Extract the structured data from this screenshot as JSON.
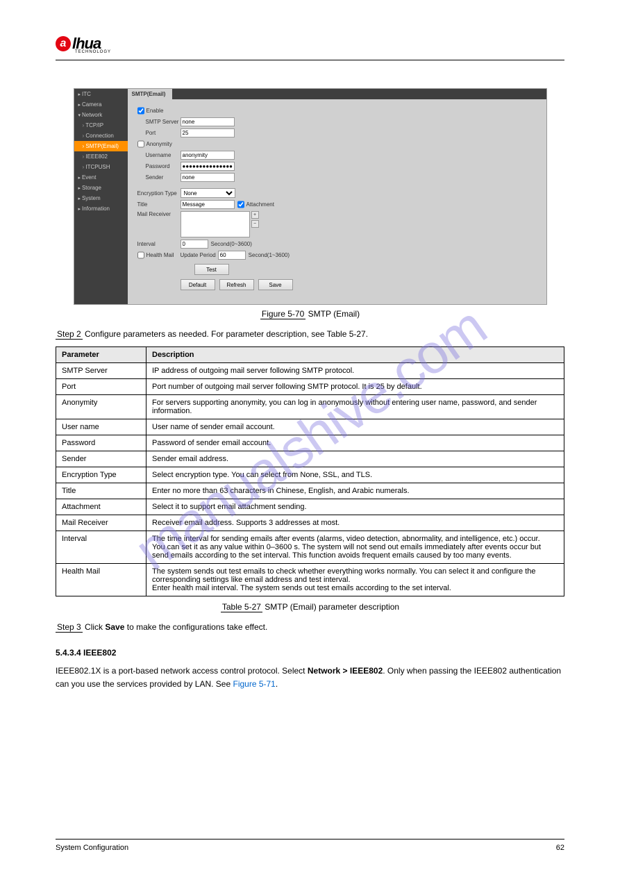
{
  "logo": {
    "brand": "lhua",
    "prefix": "a",
    "sub": "TECHNOLOGY"
  },
  "watermark": "manualshive.com",
  "sidebar": {
    "items": [
      {
        "label": "ITC",
        "cls": "collapse"
      },
      {
        "label": "Camera",
        "cls": "collapse"
      },
      {
        "label": "Network",
        "cls": "expand"
      },
      {
        "label": "TCP/IP",
        "cls": "sub sub-arrow"
      },
      {
        "label": "Connection",
        "cls": "sub sub-arrow"
      },
      {
        "label": "SMTP(Email)",
        "cls": "sub active sub-arrow"
      },
      {
        "label": "IEEE802",
        "cls": "sub sub-arrow"
      },
      {
        "label": "ITCPUSH",
        "cls": "sub sub-arrow"
      },
      {
        "label": "Event",
        "cls": "collapse"
      },
      {
        "label": "Storage",
        "cls": "collapse"
      },
      {
        "label": "System",
        "cls": "collapse"
      },
      {
        "label": "Information",
        "cls": "collapse"
      }
    ]
  },
  "form": {
    "tab": "SMTP(Email)",
    "enable_label": "Enable",
    "enable_checked": true,
    "smtp_server_label": "SMTP Server",
    "smtp_server_value": "none",
    "port_label": "Port",
    "port_value": "25",
    "anonymity_label": "Anonymity",
    "anonymity_checked": false,
    "username_label": "Username",
    "username_value": "anonymity",
    "password_label": "Password",
    "password_value": "●●●●●●●●●●●●●●●●●",
    "sender_label": "Sender",
    "sender_value": "none",
    "encryption_label": "Encryption Type",
    "encryption_value": "None",
    "title_label": "Title",
    "title_value": "Message",
    "attachment_label": "Attachment",
    "attachment_checked": true,
    "mail_receiver_label": "Mail Receiver",
    "interval_label": "Interval",
    "interval_value": "0",
    "interval_hint": "Second(0~3600)",
    "health_mail_label": "Health Mail",
    "health_mail_checked": false,
    "update_period_label": "Update Period",
    "update_period_value": "60",
    "update_period_hint": "Second(1~3600)",
    "test_btn": "Test",
    "default_btn": "Default",
    "refresh_btn": "Refresh",
    "save_btn": "Save"
  },
  "figure": {
    "label": "Figure 5-70",
    "title": "SMTP (Email)"
  },
  "step": {
    "prefix": "Step 2",
    "text": "Configure parameters as needed. For parameter description, see Table 5-27."
  },
  "table": {
    "headers": [
      "Parameter",
      "Description"
    ],
    "rows": [
      [
        "SMTP Server",
        "IP address of outgoing mail server following SMTP protocol."
      ],
      [
        "Port",
        "Port number of outgoing mail server following SMTP protocol. It is 25 by default."
      ],
      [
        "Anonymity",
        "For servers supporting anonymity, you can log in anonymously without entering user name, password, and sender information."
      ],
      [
        "User name",
        "User name of sender email account."
      ],
      [
        "Password",
        "Password of sender email account."
      ],
      [
        "Sender",
        "Sender email address."
      ],
      [
        "Encryption Type",
        "Select encryption type. You can select from None, SSL, and TLS."
      ],
      [
        "Title",
        "Enter no more than 63 characters in Chinese, English, and Arabic numerals."
      ],
      [
        "Attachment",
        "Select it to support email attachment sending."
      ],
      [
        "Mail Receiver",
        "Receiver email address. Supports 3 addresses at most."
      ],
      [
        "Interval",
        "The time interval for sending emails after events (alarms, video detection, abnormality, and intelligence, etc.) occur.\nYou can set it as any value within 0–3600 s. The system will not send out emails immediately after events occur but send emails according to the set interval. This function avoids frequent emails caused by too many events."
      ],
      [
        "Health Mail",
        "The system sends out test emails to check whether everything works normally. You can select it and configure the corresponding settings like email address and test interval.\nEnter health mail interval. The system sends out test emails according to the set interval."
      ]
    ]
  },
  "tablecap": {
    "label": "Table 5-27",
    "title": "SMTP (Email) parameter description"
  },
  "step3": {
    "prefix": "Step 3",
    "text": "Click Save to make the configurations take effect."
  },
  "section": {
    "num": "5.4.3.4",
    "title": "IEEE802"
  },
  "body": {
    "line1_pre": "IEEE802.1X is a port-based network access control protocol. Select ",
    "line1_bold": "Network > IEEE802",
    "line1_post": ". ",
    "line2_pre": "Only when passing the IEEE802 authentication can you use the services provided by LAN. See ",
    "line2_link": "Figure 5-71",
    "line2_post": "."
  },
  "footer": {
    "left": "System Configuration",
    "right": "62"
  }
}
